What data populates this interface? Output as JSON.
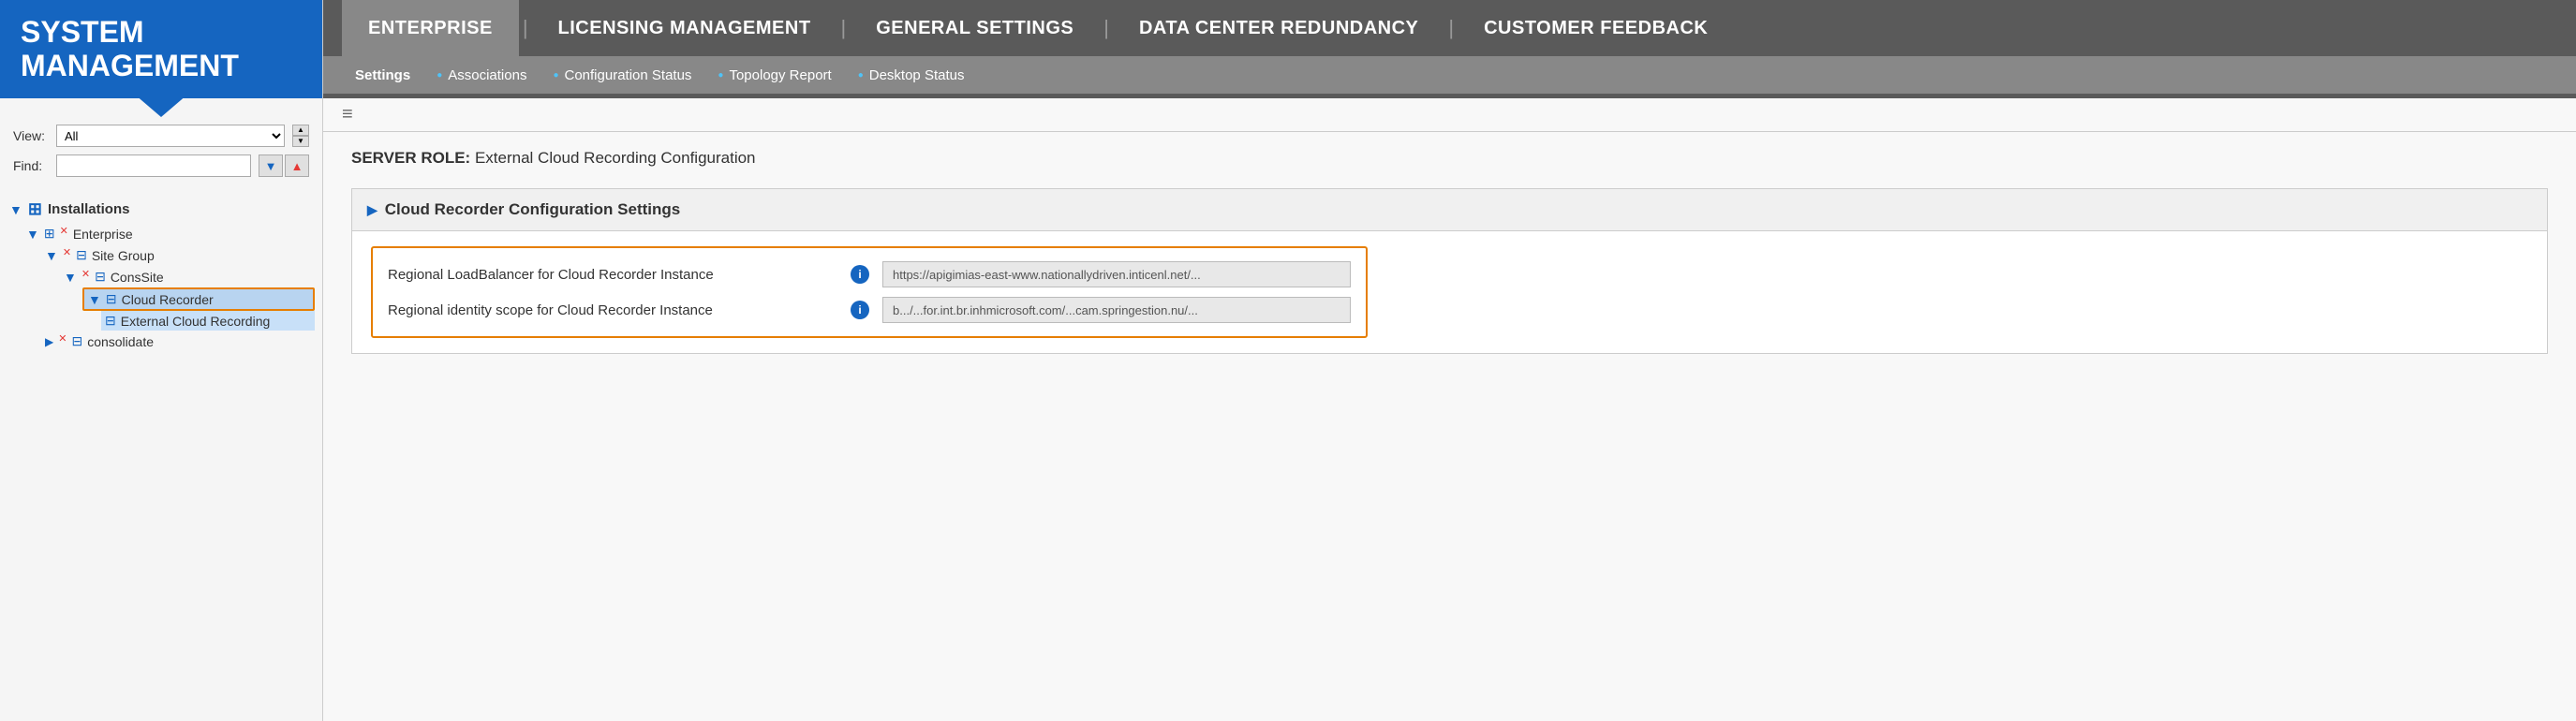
{
  "sidebar": {
    "title_line1": "SYSTEM",
    "title_line2": "MANAGEMENT",
    "view_label": "View:",
    "view_value": "All",
    "find_label": "Find:",
    "tree": {
      "installations_label": "Installations",
      "enterprise_label": "Enterprise",
      "site_group_label": "Site Group",
      "cons_site_label": "ConsSite",
      "cloud_recorder_label": "Cloud Recorder",
      "external_cloud_recording_label": "External Cloud Recording",
      "consolidate_label": "consolidate"
    }
  },
  "top_nav": {
    "items": [
      {
        "label": "ENTERPRISE",
        "active": true
      },
      {
        "label": "LICENSING MANAGEMENT",
        "active": false
      },
      {
        "label": "GENERAL SETTINGS",
        "active": false
      },
      {
        "label": "DATA CENTER REDUNDANCY",
        "active": false
      },
      {
        "label": "CUSTOMER FEEDBACK",
        "active": false
      }
    ],
    "sub_items": [
      {
        "label": "Settings",
        "active": true,
        "bullet": false
      },
      {
        "label": "Associations",
        "active": false,
        "bullet": true
      },
      {
        "label": "Configuration Status",
        "active": false,
        "bullet": true
      },
      {
        "label": "Topology Report",
        "active": false,
        "bullet": true
      },
      {
        "label": "Desktop Status",
        "active": false,
        "bullet": true
      }
    ]
  },
  "main": {
    "server_role_prefix": "SERVER ROLE:",
    "server_role_value": "External Cloud Recording Configuration",
    "section_title": "Cloud Recorder Configuration Settings",
    "fields": [
      {
        "label": "Regional LoadBalancer for Cloud Recorder Instance",
        "value": "https://apigimias-east-www.nationallydriven.inticenl.net/..."
      },
      {
        "label": "Regional identity scope for Cloud Recorder Instance",
        "value": "b.../...for.int.br.inhmicrosoft.com/...cam.springestion.nu/..."
      }
    ]
  },
  "icons": {
    "collapse_arrow": "▶",
    "tree_toggle": "▼",
    "info": "i",
    "spin_up": "▲",
    "spin_down": "▼",
    "filter_down": "▼",
    "filter_up": "▲"
  }
}
